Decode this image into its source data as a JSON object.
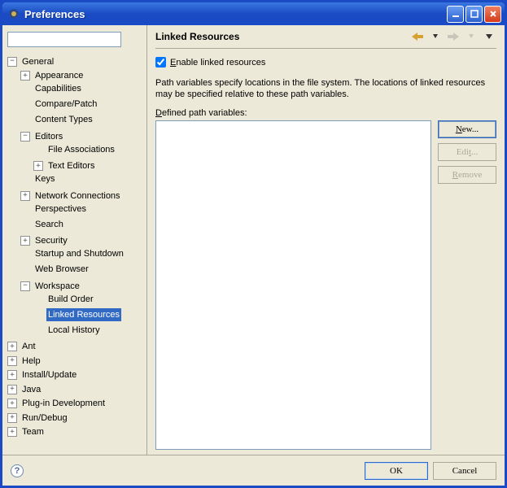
{
  "window": {
    "title": "Preferences"
  },
  "tree": {
    "general": {
      "label": "General",
      "appearance": "Appearance",
      "capabilities": "Capabilities",
      "compare_patch": "Compare/Patch",
      "content_types": "Content Types",
      "editors": {
        "label": "Editors",
        "file_assoc": "File Associations",
        "text_editors": "Text Editors"
      },
      "keys": "Keys",
      "network": "Network Connections",
      "perspectives": "Perspectives",
      "search": "Search",
      "security": "Security",
      "startup": "Startup and Shutdown",
      "web_browser": "Web Browser",
      "workspace": {
        "label": "Workspace",
        "build_order": "Build Order",
        "linked_resources": "Linked Resources",
        "local_history": "Local History"
      }
    },
    "ant": "Ant",
    "help": "Help",
    "install": "Install/Update",
    "java": "Java",
    "plugin_dev": "Plug-in Development",
    "run_debug": "Run/Debug",
    "team": "Team"
  },
  "page": {
    "title": "Linked Resources",
    "enable_label": "Enable linked resources",
    "enable_checked": true,
    "description": "Path variables specify locations in the file system. The locations of linked resources may be specified relative to these path variables.",
    "defined_label": "Defined path variables:",
    "buttons": {
      "new": "New...",
      "edit": "Edit...",
      "remove": "Remove"
    }
  },
  "footer": {
    "ok": "OK",
    "cancel": "Cancel"
  }
}
